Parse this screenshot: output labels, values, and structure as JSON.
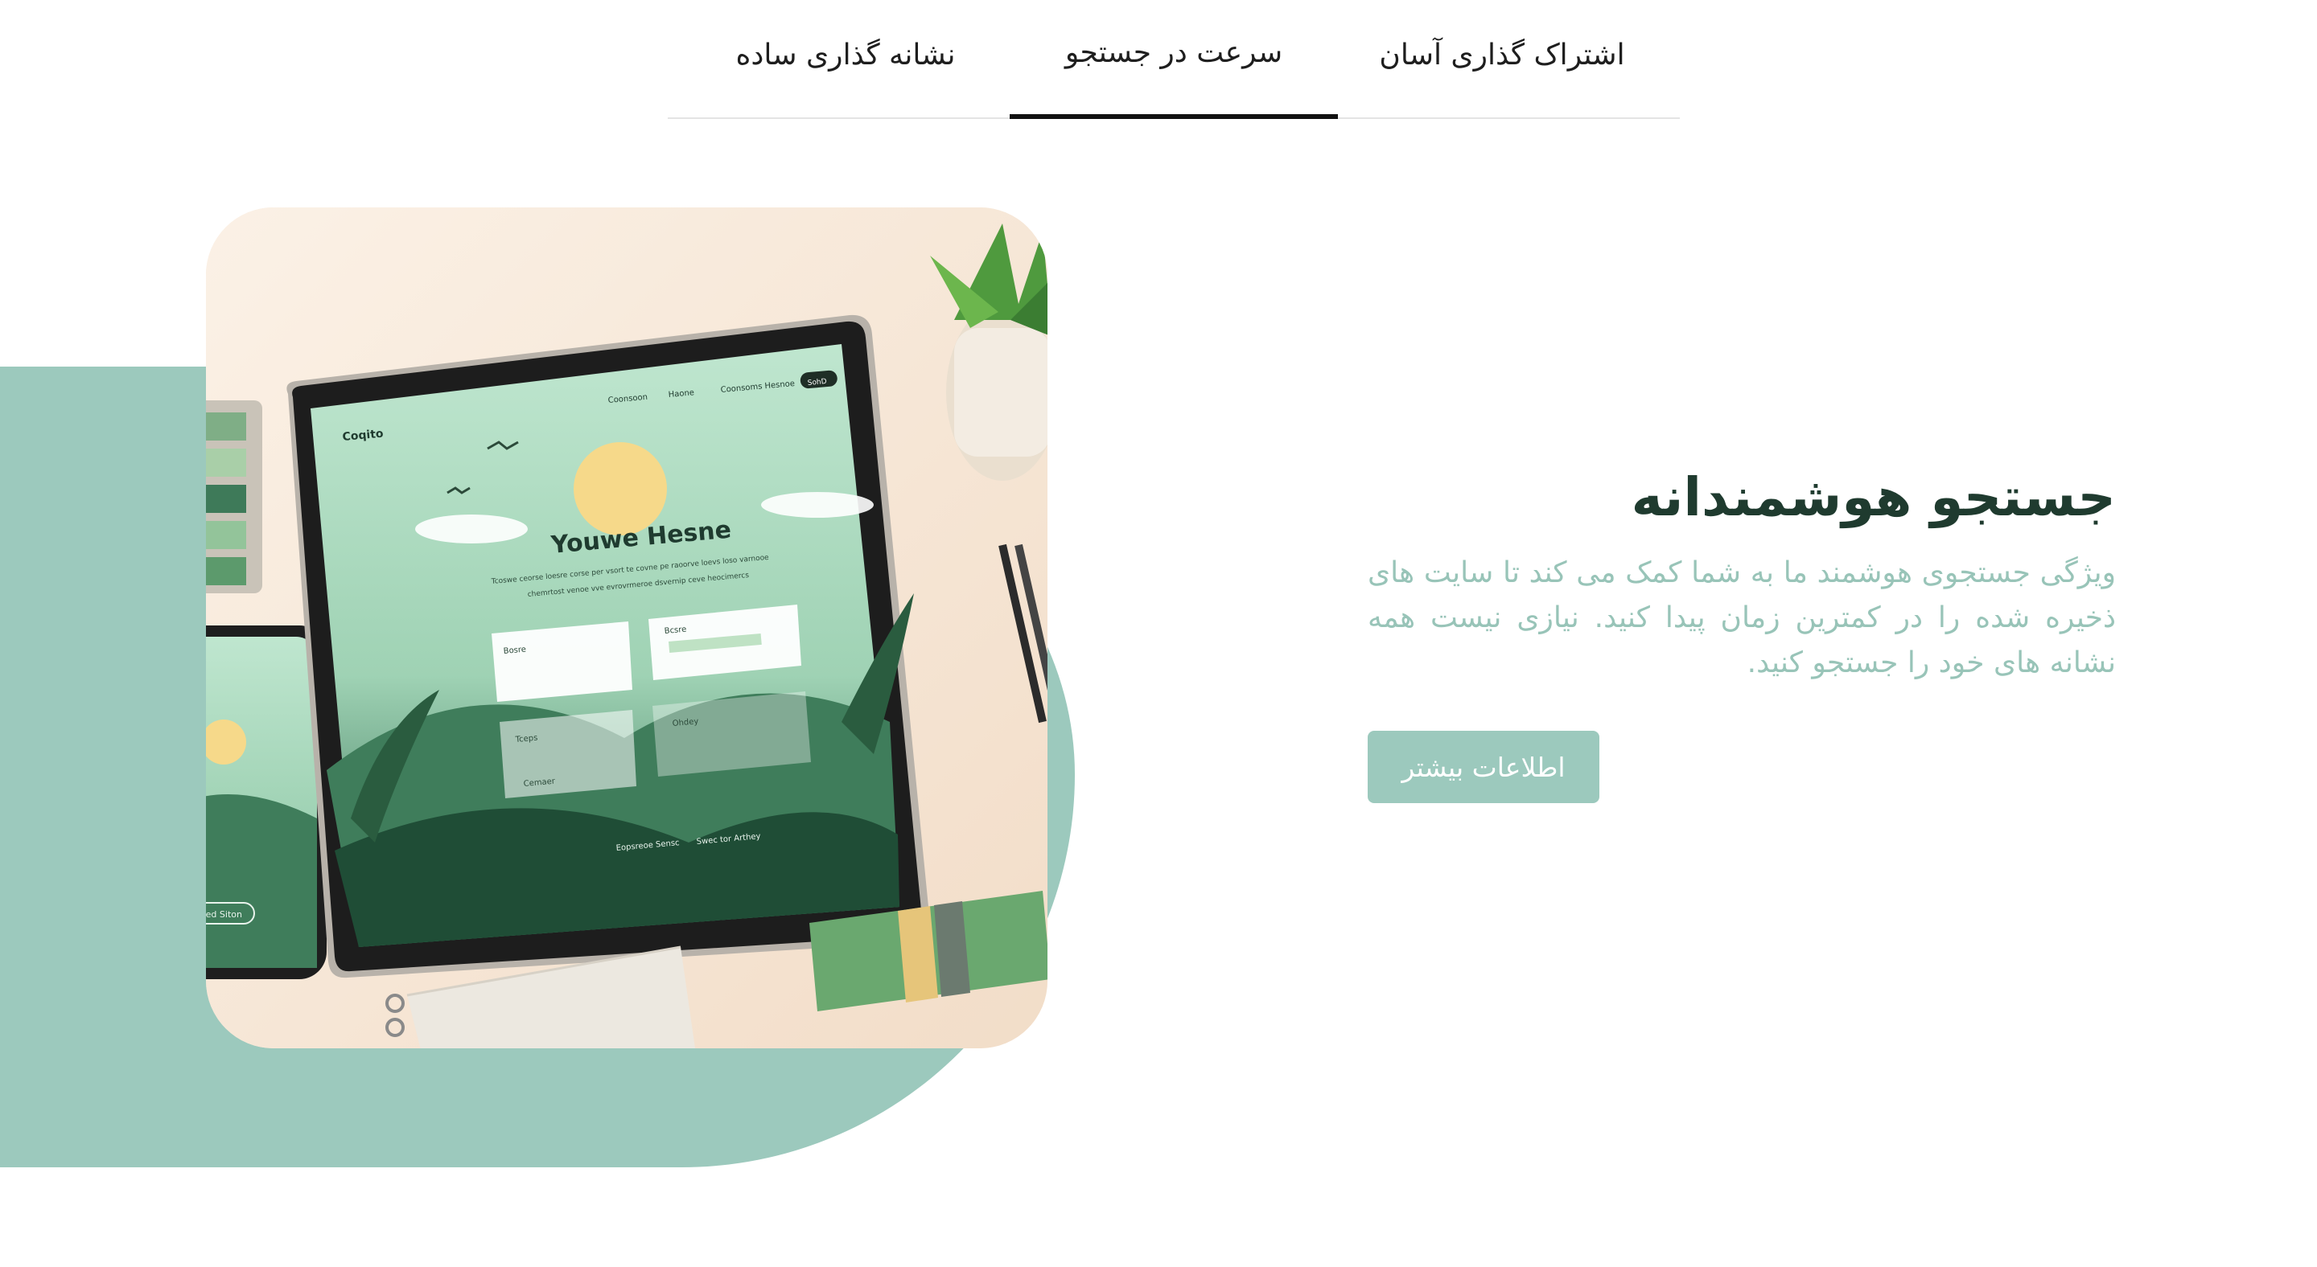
{
  "tabs": [
    {
      "label": "اشتراک گذاری آسان",
      "active": false
    },
    {
      "label": "سرعت در جستجو",
      "active": true
    },
    {
      "label": "نشانه گذاری ساده",
      "active": false
    }
  ],
  "hero": {
    "title": "جستجو هوشمندانه",
    "description": "ویژگی جستجوی هوشمند ما به شما کمک می کند تا سایت های ذخیره شده را در کمترین زمان پیدا کنید. نیازی نیست همه نشانه های خود را جستجو کنید.",
    "button_label": "اطلاعات بیشتر",
    "image": {
      "logo_text": "Coqito",
      "nav": [
        "Coonsoon",
        "Haone",
        "Coonsoms Hesnoe",
        "SohD"
      ],
      "heading": "Youwe Hesne",
      "subtext_1": "Tcoswe ceorse loesre corse per vsort te covne pe raoorve loevs loso varnooe",
      "subtext_2": "chemrtost venoe vve evrovrmeroe dsvernip ceve heocimercs",
      "form_labels": [
        "Bosre",
        "Bcsre",
        "Tceps",
        "Ohdey",
        "Cemaer"
      ],
      "footer_links": [
        "Eopsreoe Sensc",
        "Swec tor Arthey"
      ],
      "phone_button": "Rbed Siton"
    }
  },
  "colors": {
    "accent": "#9cc9bd",
    "heading": "#1f3b2f",
    "description": "#98c4b8",
    "tab_text": "#1e1e1e",
    "tab_active_indicator": "#111111"
  }
}
